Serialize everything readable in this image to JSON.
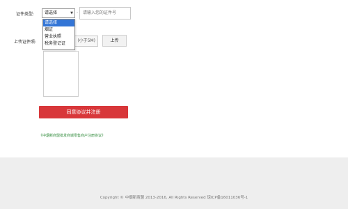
{
  "form": {
    "id_type_label": "证件类型:",
    "id_type_selected": "请选择",
    "id_type_options": [
      "请选择",
      "烟证",
      "营业执照",
      "税务登记证"
    ],
    "id_number_placeholder": "请输入您的证件号",
    "upload_label": "上传证件照:",
    "upload_hint": "(小于5M)",
    "upload_button": "上传"
  },
  "actions": {
    "agree_register": "同意协议并注册",
    "agreement_link": "《中烟新商盟批发商城零售商户注册协议》"
  },
  "footer": {
    "copyright": "Copyright © 中烟新商盟 2013-2016, All Rights Reserved 琼ICP备16011036号-1"
  },
  "colors": {
    "primary_button": "#d8373a",
    "link_green": "#2f8a3a",
    "dropdown_highlight": "#3375d6"
  }
}
